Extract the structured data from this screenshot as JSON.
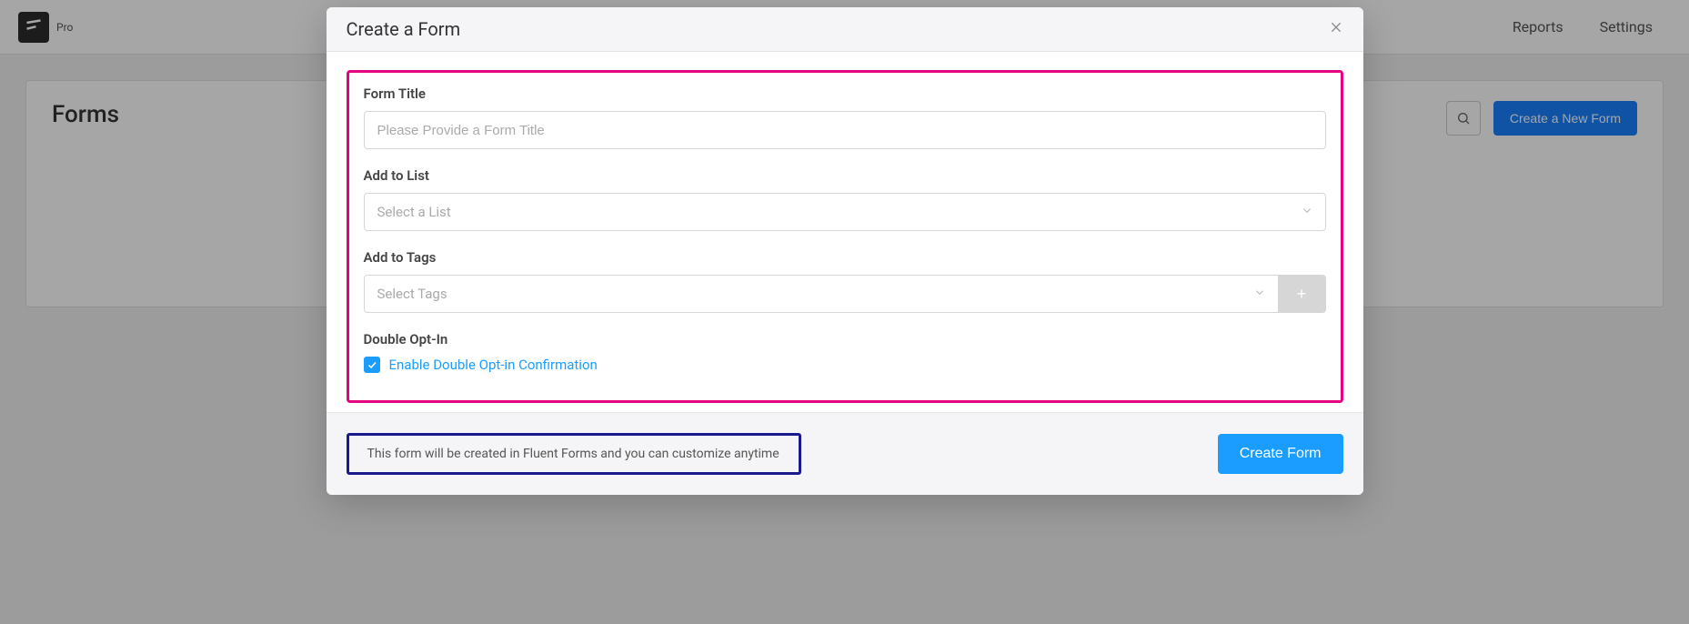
{
  "topbar": {
    "pro_label": "Pro"
  },
  "nav": {
    "reports": "Reports",
    "settings": "Settings"
  },
  "page": {
    "title": "Forms",
    "create_button": "Create a New Form"
  },
  "modal": {
    "title": "Create a Form",
    "form_title_label": "Form Title",
    "form_title_placeholder": "Please Provide a Form Title",
    "add_to_list_label": "Add to List",
    "add_to_list_placeholder": "Select a List",
    "add_to_tags_label": "Add to Tags",
    "add_to_tags_placeholder": "Select Tags",
    "double_optin_label": "Double Opt-In",
    "double_optin_checkbox": "Enable Double Opt-in Confirmation",
    "footer_note": "This form will be created in Fluent Forms and you can customize anytime",
    "submit_label": "Create Form"
  }
}
